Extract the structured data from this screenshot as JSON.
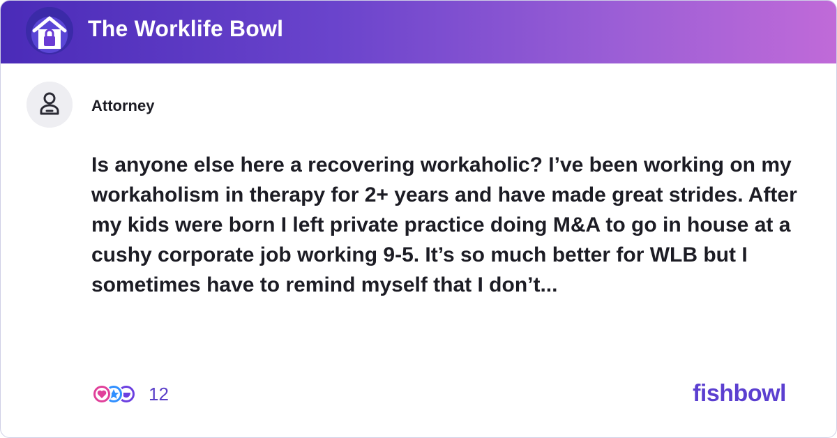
{
  "header": {
    "bowl_name": "The Worklife Bowl",
    "bowl_icon": "house-lock-icon"
  },
  "post": {
    "author_icon": "person-icon",
    "author": "Attorney",
    "body": "Is anyone else here a recovering workaholic? I’ve been working on my workaholism in therapy for 2+ years and have made great strides. After my kids were born I left private practice doing M&A to go in house at a cushy corporate job working 9-5. It’s so much better for WLB but I sometimes have to remind myself that I don’t..."
  },
  "footer": {
    "reaction_icons": [
      "heart-icon",
      "star-icon",
      "laugh-icon"
    ],
    "reaction_count": "12",
    "brand": "fishbowl"
  },
  "colors": {
    "header_gradient_start": "#4a2bb8",
    "header_gradient_end": "#c06ad8",
    "accent": "#5b3fd0",
    "text": "#1c1c24"
  }
}
